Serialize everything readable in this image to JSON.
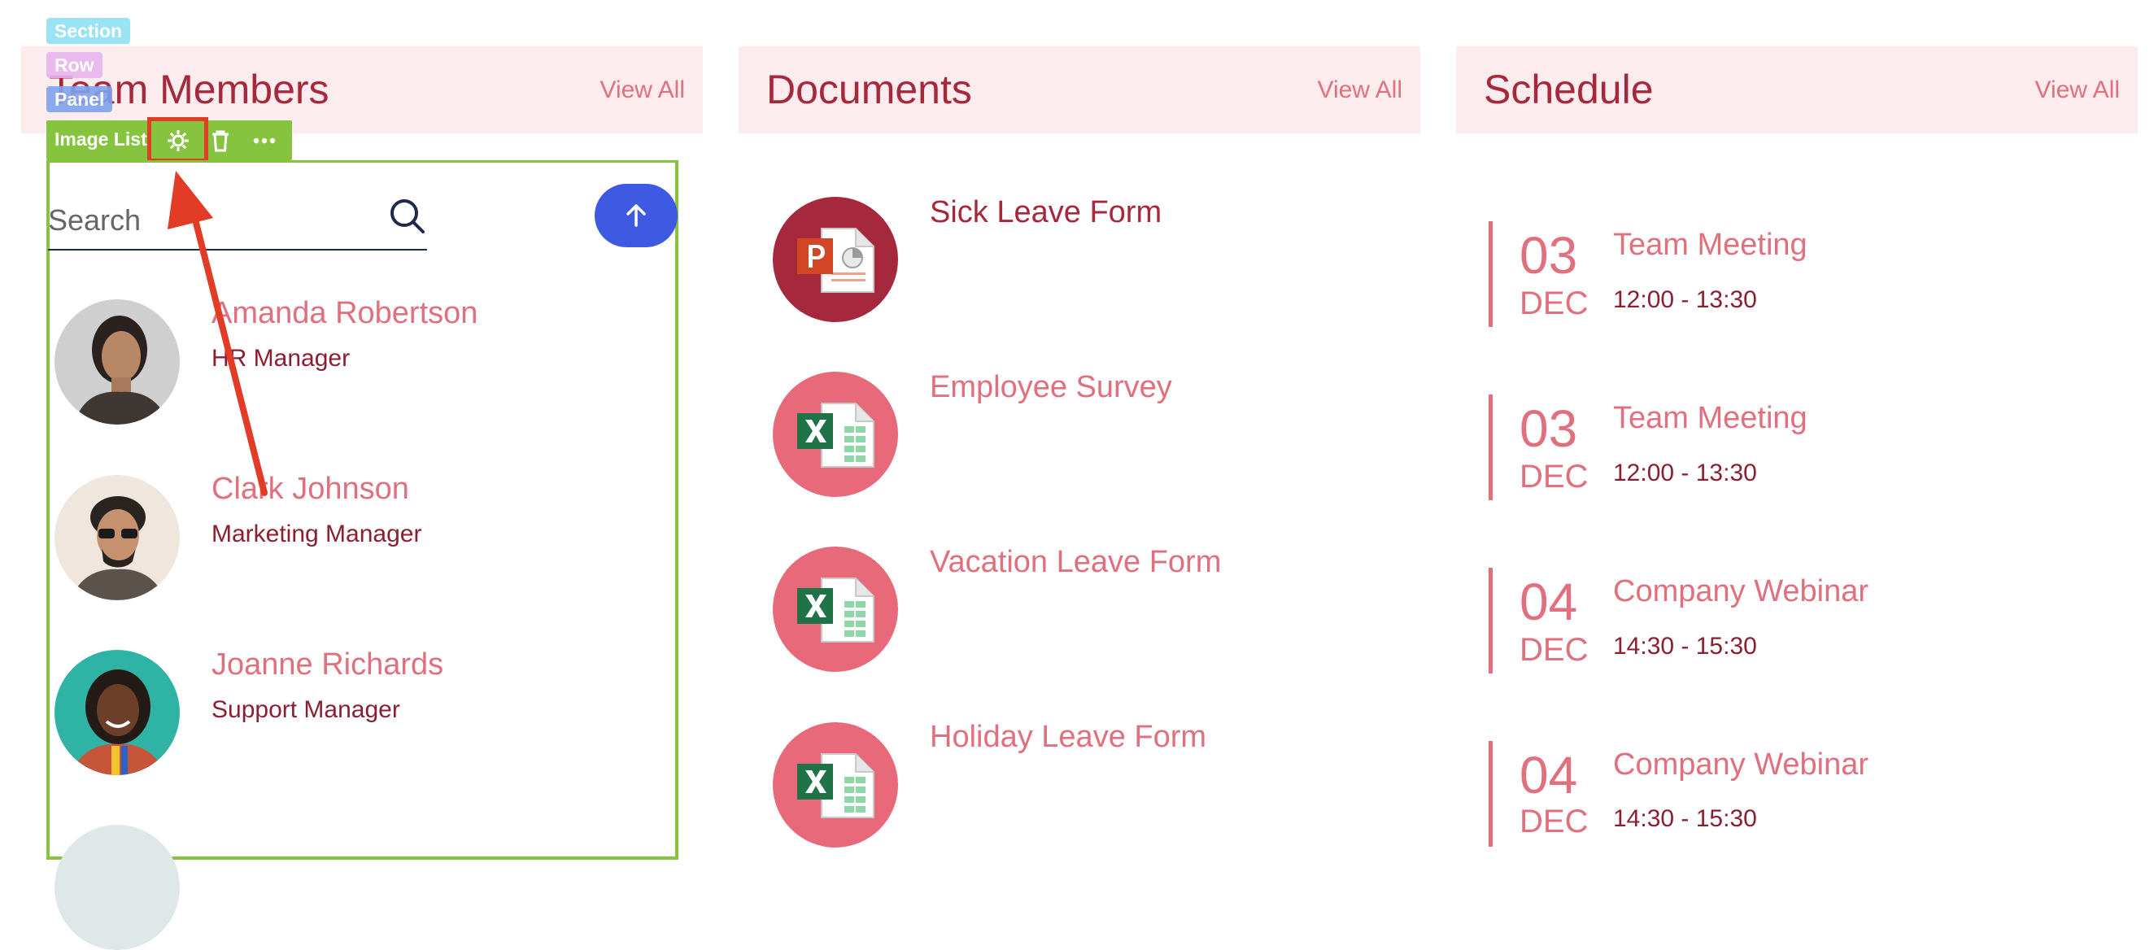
{
  "editor_tags": {
    "section": "Section",
    "row": "Row",
    "panel": "Panel"
  },
  "widget": {
    "label": "Image List"
  },
  "team": {
    "title": "Team Members",
    "view_all": "View All",
    "search_placeholder": "Search",
    "members": [
      {
        "name": "Amanda Robertson",
        "role": "HR Manager"
      },
      {
        "name": "Clark Johnson",
        "role": "Marketing Manager"
      },
      {
        "name": "Joanne Richards",
        "role": "Support Manager"
      }
    ]
  },
  "documents": {
    "title": "Documents",
    "view_all": "View All",
    "items": [
      {
        "title": "Sick Leave Form",
        "type": "powerpoint"
      },
      {
        "title": "Employee Survey",
        "type": "excel"
      },
      {
        "title": "Vacation Leave Form",
        "type": "excel"
      },
      {
        "title": "Holiday Leave Form",
        "type": "excel"
      }
    ]
  },
  "schedule": {
    "title": "Schedule",
    "view_all": "View All",
    "events": [
      {
        "day": "03",
        "month": "DEC",
        "title": "Team Meeting",
        "time": "12:00 - 13:30"
      },
      {
        "day": "03",
        "month": "DEC",
        "title": "Team Meeting",
        "time": "12:00 - 13:30"
      },
      {
        "day": "04",
        "month": "DEC",
        "title": "Company Webinar",
        "time": "14:30 - 15:30"
      },
      {
        "day": "04",
        "month": "DEC",
        "title": "Company Webinar",
        "time": "14:30 - 15:30"
      }
    ]
  },
  "colors": {
    "header_bg": "#fdeced",
    "title": "#a5283c",
    "accent_pink": "#e0707e",
    "dark_red": "#8a1f32",
    "widget_green": "#86c440",
    "annotation_red": "#e23b26",
    "scroll_button": "#3e5ae2"
  }
}
